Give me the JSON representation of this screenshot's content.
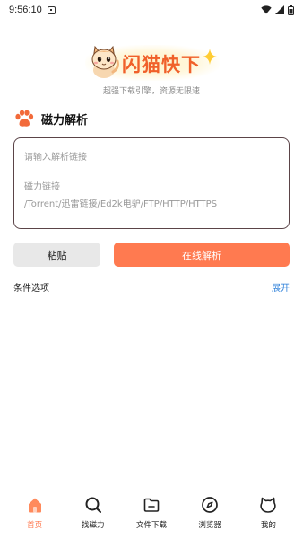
{
  "status": {
    "time": "9:56:10"
  },
  "app": {
    "title": "闪猫快下",
    "slogan": "超强下载引擎，资源无限速"
  },
  "section": {
    "title": "磁力解析",
    "icon": "paw-icon"
  },
  "input": {
    "placeholder": "请输入解析链接",
    "hint_line1": "磁力链接",
    "hint_line2": "/Torrent/迅雷链接/Ed2k电驴/FTP/HTTP/HTTPS"
  },
  "buttons": {
    "paste": "粘贴",
    "parse": "在线解析"
  },
  "options": {
    "label": "条件选项",
    "expand": "展开"
  },
  "tabs": [
    {
      "label": "首页",
      "icon": "home-icon",
      "active": true
    },
    {
      "label": "找磁力",
      "icon": "search-icon",
      "active": false
    },
    {
      "label": "文件下载",
      "icon": "folder-icon",
      "active": false
    },
    {
      "label": "浏览器",
      "icon": "compass-icon",
      "active": false
    },
    {
      "label": "我的",
      "icon": "cat-face-icon",
      "active": false
    }
  ],
  "colors": {
    "accent": "#ff7a50",
    "brand_title": "#f0602a",
    "link": "#2a7ed9",
    "input_border": "#5b4448"
  }
}
